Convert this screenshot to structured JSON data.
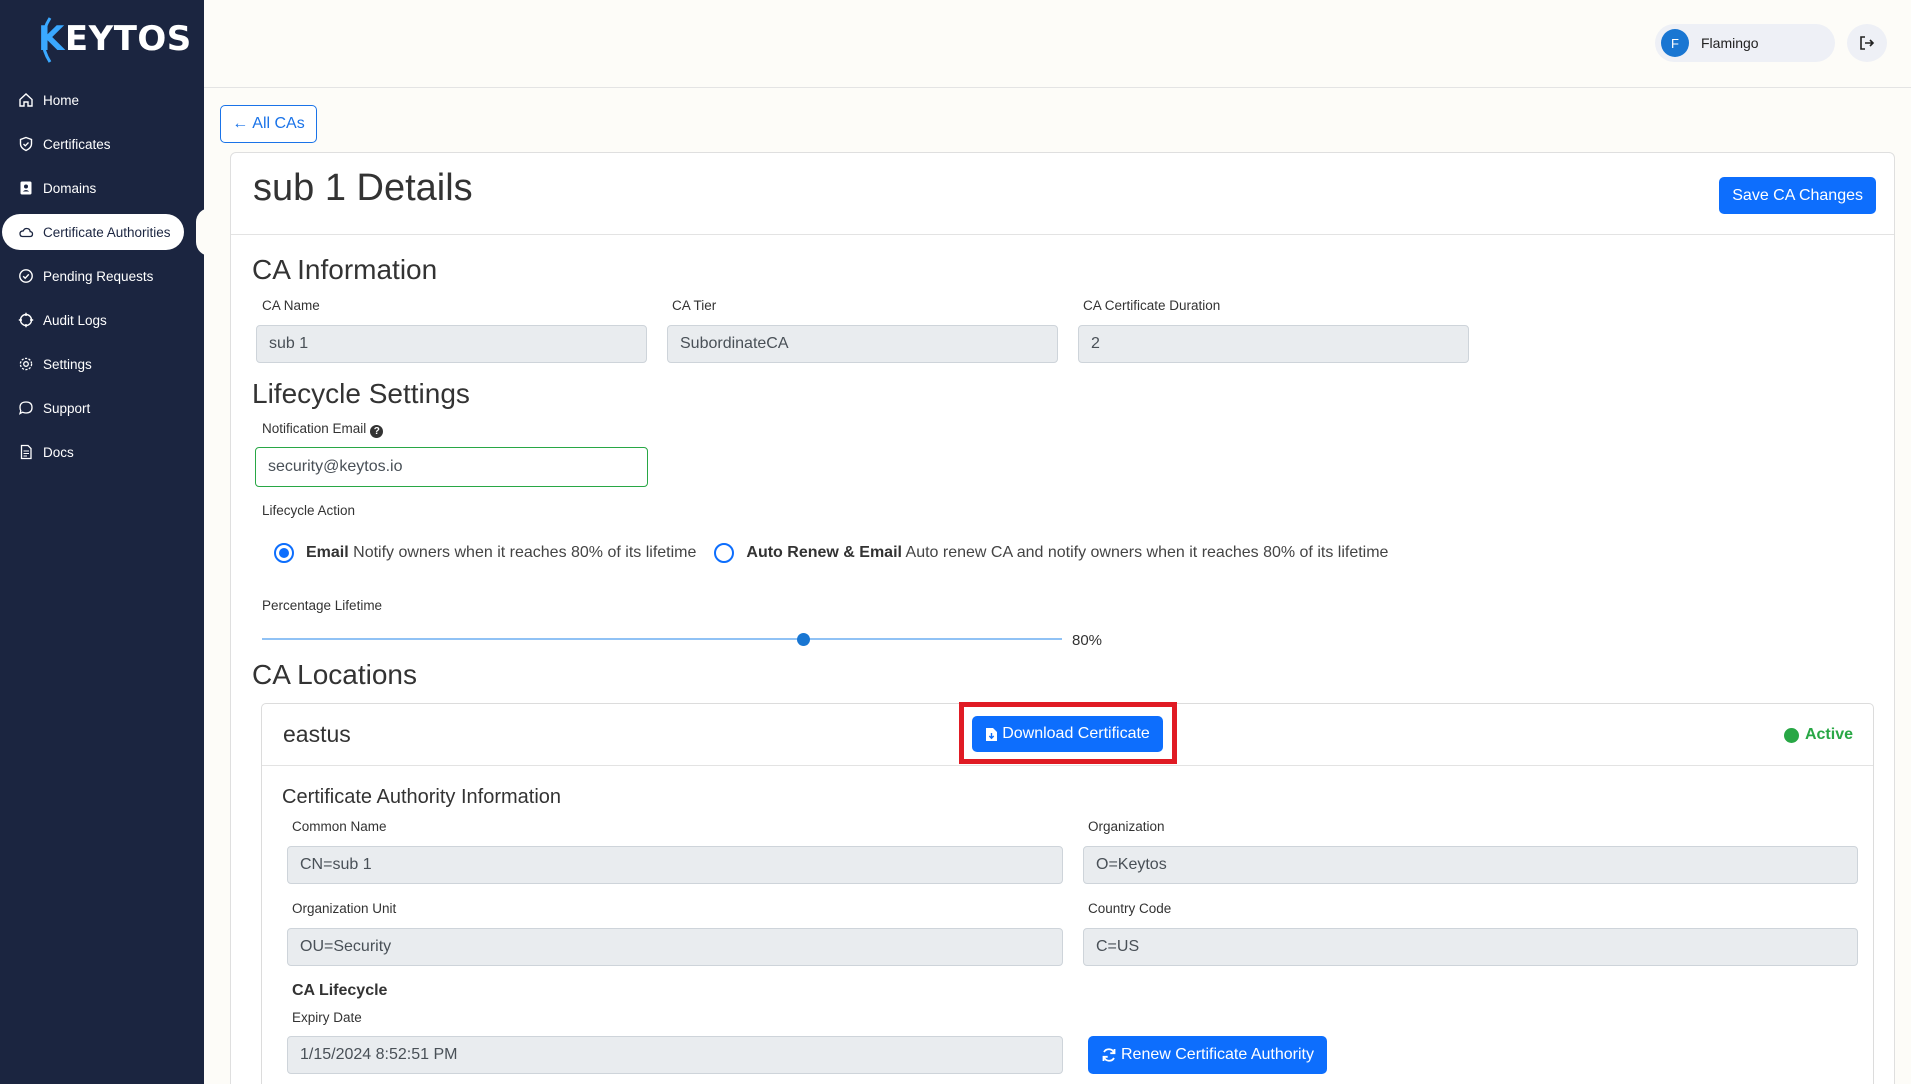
{
  "brand": {
    "logo": "KEYTOS"
  },
  "sidebar": {
    "items": [
      {
        "label": "Home",
        "icon": "home-icon"
      },
      {
        "label": "Certificates",
        "icon": "shield-icon"
      },
      {
        "label": "Domains",
        "icon": "contacts-icon"
      },
      {
        "label": "Certificate Authorities",
        "icon": "cloud-icon"
      },
      {
        "label": "Pending Requests",
        "icon": "check-circle-icon"
      },
      {
        "label": "Audit Logs",
        "icon": "crosshair-icon"
      },
      {
        "label": "Settings",
        "icon": "gear-icon"
      },
      {
        "label": "Support",
        "icon": "chat-icon"
      },
      {
        "label": "Docs",
        "icon": "document-icon"
      }
    ]
  },
  "header": {
    "user_initial": "F",
    "user_name": "Flamingo"
  },
  "nav": {
    "back_label": "All CAs"
  },
  "page": {
    "title": "sub 1 Details",
    "save_label": "Save CA Changes"
  },
  "ca_info": {
    "title": "CA Information",
    "name_label": "CA Name",
    "name_value": "sub 1",
    "tier_label": "CA Tier",
    "tier_value": "SubordinateCA",
    "duration_label": "CA Certificate Duration",
    "duration_value": "2"
  },
  "lifecycle": {
    "title": "Lifecycle Settings",
    "email_label": "Notification Email",
    "email_value": "security@keytos.io",
    "action_label": "Lifecycle Action",
    "options": [
      {
        "bold": "Email",
        "text": " Notify owners when it reaches 80% of its lifetime",
        "checked": true
      },
      {
        "bold": "Auto Renew & Email",
        "text": " Auto renew CA and notify owners when it reaches 80% of its lifetime",
        "checked": false
      }
    ],
    "percentage_label": "Percentage Lifetime",
    "percentage_value": "80%"
  },
  "locations": {
    "title": "CA Locations",
    "items": [
      {
        "name": "eastus",
        "download_label": "Download Certificate",
        "status": "Active",
        "info_title": "Certificate Authority Information",
        "common_name_label": "Common Name",
        "common_name_value": "CN=sub 1",
        "org_label": "Organization",
        "org_value": "O=Keytos",
        "ou_label": "Organization Unit",
        "ou_value": "OU=Security",
        "country_label": "Country Code",
        "country_value": "C=US",
        "lifecycle_title": "CA Lifecycle",
        "expiry_label": "Expiry Date",
        "expiry_value": "1/15/2024 8:52:51 PM",
        "renew_label": "Renew Certificate Authority"
      }
    ]
  },
  "colors": {
    "sidebar": "#1b2540",
    "primary": "#0d6efd",
    "active": "#28a745",
    "highlight": "#e01b24"
  }
}
